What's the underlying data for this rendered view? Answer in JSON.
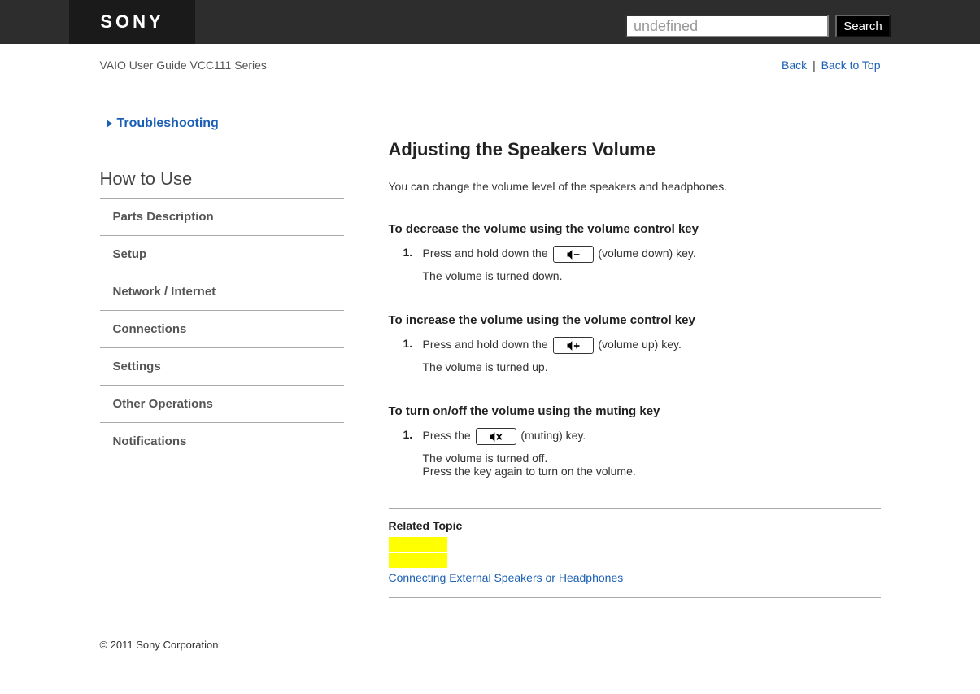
{
  "header": {
    "logo": "SONY",
    "search_placeholder": "undefined",
    "search_button": "Search"
  },
  "topnav": {
    "breadcrumb": "VAIO User Guide VCC111 Series",
    "back": "Back",
    "back_to_top": "Back to Top"
  },
  "sidebar": {
    "troubleshooting": "Troubleshooting",
    "menu_header": "How to Use",
    "items": [
      "Parts Description",
      "Setup",
      "Network / Internet",
      "Connections",
      "Settings",
      "Other Operations",
      "Notifications"
    ]
  },
  "content": {
    "title": "Adjusting the Speakers Volume",
    "intro": "You can change the volume level of the speakers and headphones.",
    "sections": [
      {
        "title": "To decrease the volume using the volume control key",
        "step_num": "1.",
        "step_pre": "Press and hold down the ",
        "step_post": " (volume down) key.",
        "icon": "volume-down",
        "result": "The volume is turned down."
      },
      {
        "title": "To increase the volume using the volume control key",
        "step_num": "1.",
        "step_pre": "Press and hold down the ",
        "step_post": " (volume up) key.",
        "icon": "volume-up",
        "result": "The volume is turned up."
      },
      {
        "title": "To turn on/off the volume using the muting key",
        "step_num": "1.",
        "step_pre": "Press the ",
        "step_post": " (muting) key.",
        "icon": "mute",
        "result": "The volume is turned off.\nPress the key again to turn on the volume."
      }
    ],
    "related_title": "Related Topic",
    "related_link": "Connecting External Speakers or Headphones"
  },
  "footer": "© 2011 Sony Corporation"
}
